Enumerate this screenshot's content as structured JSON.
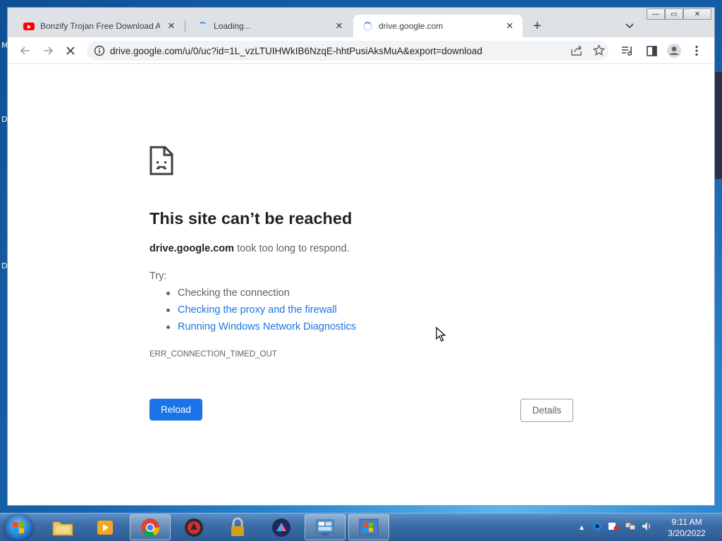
{
  "browser": {
    "tabs": [
      {
        "title": "Bonzify Trojan Free Download All",
        "favicon": "youtube-icon"
      },
      {
        "title": "Loading...",
        "favicon": "loading-spinner-icon"
      },
      {
        "title": "drive.google.com",
        "favicon": "loading-spinner-icon"
      }
    ],
    "window_controls": {
      "minimize": "—",
      "maximize": "▭",
      "close": "✕"
    },
    "address_url": "drive.google.com/u/0/uc?id=1L_vzLTUIHWkIB6NzqE-hhtPusiAksMuA&export=download"
  },
  "error_page": {
    "icon": "sad-page-icon",
    "heading": "This site can’t be reached",
    "host": "drive.google.com",
    "desc_rest": " took too long to respond.",
    "try_label": "Try:",
    "suggestions": [
      "Checking the connection",
      "Checking the proxy and the firewall",
      "Running Windows Network Diagnostics"
    ],
    "error_code": "ERR_CONNECTION_TIMED_OUT",
    "reload_label": "Reload",
    "details_label": "Details"
  },
  "desktop": {
    "side_letters": [
      "M",
      "D",
      "D"
    ]
  },
  "taskbar": {
    "apps": [
      "file-explorer-icon",
      "media-player-icon",
      "chrome-icon",
      "antivirus-icon",
      "lock-icon",
      "app-icon",
      "control-panel-icon",
      "windows-icon"
    ],
    "clock_time": "9:11 AM",
    "clock_date": "3/20/2022"
  },
  "colors": {
    "link": "#1a73e8",
    "reload_button": "#1a73e8",
    "tab_strip": "#dee1e6"
  }
}
